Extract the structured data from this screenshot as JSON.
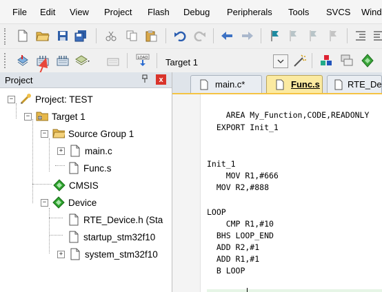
{
  "menu": [
    "File",
    "Edit",
    "View",
    "Project",
    "Flash",
    "Debug",
    "Peripherals",
    "Tools",
    "SVCS",
    "Wind"
  ],
  "toolbar2": {
    "target_name": "Target 1"
  },
  "project_panel": {
    "title": "Project",
    "pin_glyph": "p",
    "close_glyph": "x",
    "tree": [
      {
        "label": "Project: TEST",
        "icon": "project-icon"
      },
      {
        "label": "Target 1",
        "icon": "target-folder-icon"
      },
      {
        "label": "Source Group 1",
        "icon": "folder-icon"
      },
      {
        "label": "main.c",
        "icon": "file-icon"
      },
      {
        "label": "Func.s",
        "icon": "file-icon"
      },
      {
        "label": "CMSIS",
        "icon": "green-diamond-icon"
      },
      {
        "label": "Device",
        "icon": "green-diamond-icon"
      },
      {
        "label": "RTE_Device.h (Sta",
        "icon": "file-icon"
      },
      {
        "label": "startup_stm32f10",
        "icon": "file-icon"
      },
      {
        "label": "system_stm32f10",
        "icon": "file-icon"
      }
    ]
  },
  "editor": {
    "tabs": [
      {
        "label": "main.c*"
      },
      {
        "label": "Func.s"
      },
      {
        "label": "RTE_De"
      }
    ],
    "code_lines": [
      "    AREA My_Function,CODE,READONLY",
      "  EXPORT Init_1",
      "",
      "",
      "Init_1",
      "    MOV R1,#666",
      "  MOV R2,#888",
      "",
      "LOOP",
      "    CMP R1,#10",
      "  BHS LOOP_END",
      "  ADD R2,#1",
      "  ADD R1,#1",
      "  B LOOP"
    ]
  },
  "colors": {
    "accent_tab": "#fbeaa1",
    "arrow_annotation": "#e8473a",
    "close_button": "#d9342b"
  }
}
